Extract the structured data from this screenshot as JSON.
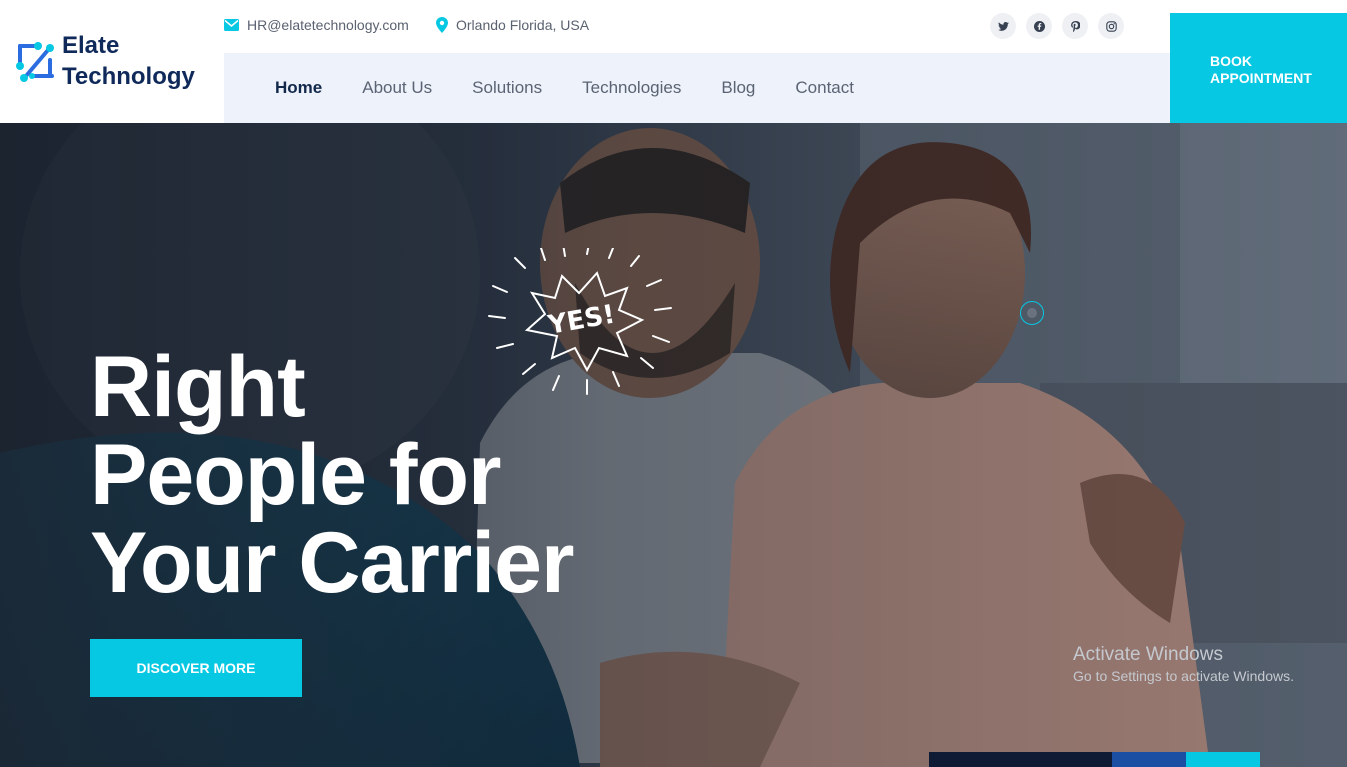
{
  "brand": {
    "line1": "Elate",
    "line2": "Technology",
    "icon": "circuit-logo-icon",
    "colors": {
      "navy": "#0f2a5a",
      "accent": "#06c8e3"
    }
  },
  "topbar": {
    "email": "HR@elatetechnology.com",
    "location": "Orlando Florida, USA",
    "social": [
      {
        "icon": "twitter-icon",
        "glyph": "🐦"
      },
      {
        "icon": "facebook-icon",
        "glyph": "f"
      },
      {
        "icon": "pinterest-icon",
        "glyph": "P"
      },
      {
        "icon": "instagram-icon",
        "glyph": "◎"
      }
    ]
  },
  "nav": {
    "items": [
      {
        "label": "Home",
        "active": true
      },
      {
        "label": "About Us"
      },
      {
        "label": "Solutions"
      },
      {
        "label": "Technologies"
      },
      {
        "label": "Blog"
      },
      {
        "label": "Contact"
      }
    ]
  },
  "cta": {
    "line1": "BOOK",
    "line2": "APPOINTMENT"
  },
  "hero": {
    "title_line1": "Right",
    "title_line2": "People for",
    "title_line3": "Your Carrier",
    "button": "DISCOVER MORE",
    "sticker": "YES!"
  },
  "watermark": {
    "title": "Activate Windows",
    "subtitle": "Go to Settings to activate Windows."
  }
}
